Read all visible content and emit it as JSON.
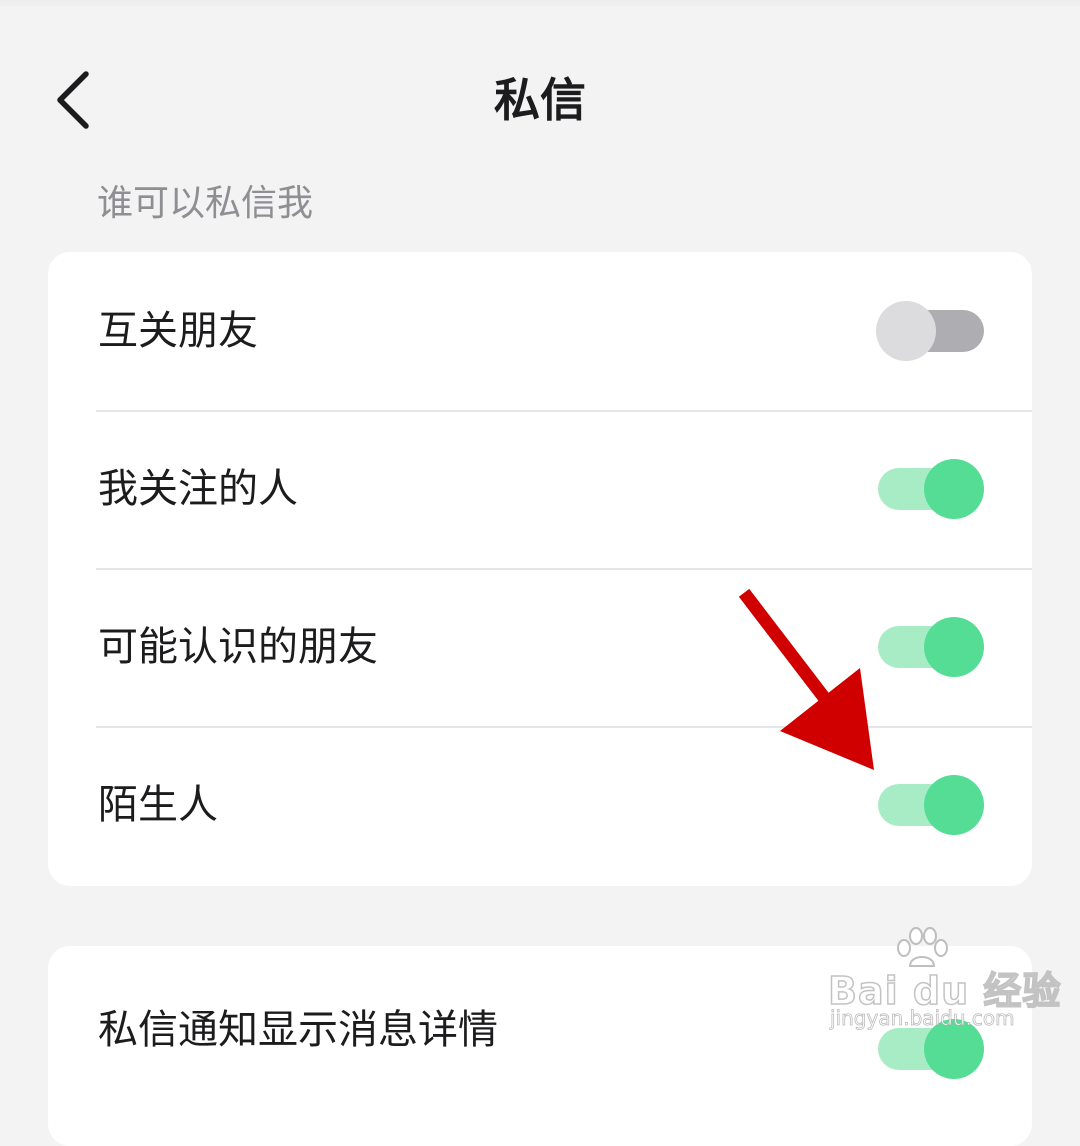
{
  "header": {
    "title": "私信",
    "back_icon": "chevron-left-icon"
  },
  "section": {
    "label": "谁可以私信我"
  },
  "options": [
    {
      "label": "互关朋友",
      "enabled": false
    },
    {
      "label": "我关注的人",
      "enabled": true
    },
    {
      "label": "可能认识的朋友",
      "enabled": true
    },
    {
      "label": "陌生人",
      "enabled": true
    }
  ],
  "notification": {
    "label": "私信通知显示消息详情",
    "enabled": true
  },
  "colors": {
    "background": "#f3f3f4",
    "toggle_on_knob": "#55dd96",
    "toggle_on_track": "#a8ecc6",
    "toggle_off_knob": "#dcdcde",
    "toggle_off_track": "#aeaeb2",
    "annotation_arrow": "#d00000"
  },
  "annotation": {
    "icon": "red-arrow-icon"
  },
  "watermark": {
    "brand": "Bai du 经验",
    "url": "jingyan.baidu.com"
  }
}
